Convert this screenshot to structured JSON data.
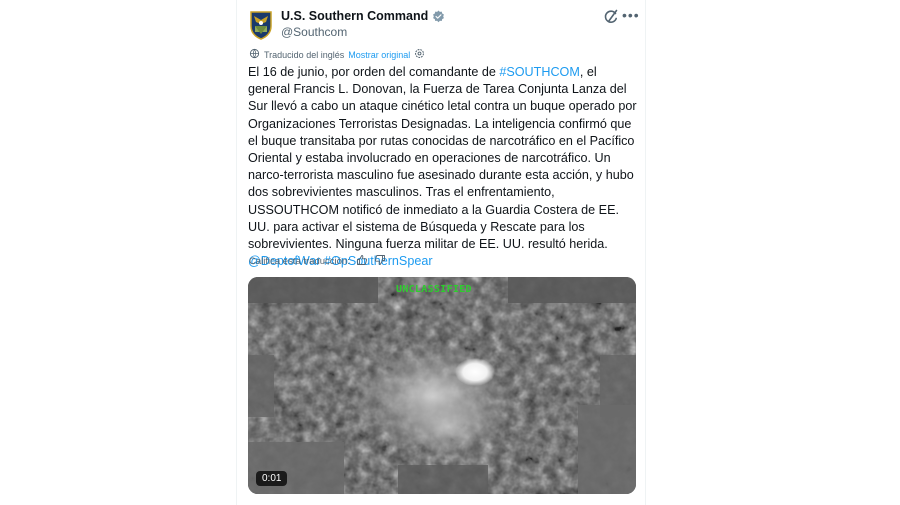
{
  "account": {
    "display_name": "U.S. Southern Command",
    "handle": "@Southcom",
    "avatar_icon": "southcom-seal-icon",
    "verified_icon": "verified-badge-icon",
    "accent_color": "#1d9bf0"
  },
  "translation": {
    "label": "Traducido del inglés",
    "show_original": "Mostrar original"
  },
  "post": {
    "text_parts": [
      "El 16 de junio, por orden del comandante de ",
      "#SOUTHCOM",
      ", el general Francis L. Donovan, la Fuerza de Tarea Conjunta Lanza del Sur llevó a cabo un ataque cinético letal contra un buque operado por Organizaciones Terroristas Designadas. La inteligencia confirmó que el buque transitaba por rutas conocidas de narcotráfico en el Pacífico Oriental y estaba involucrado en operaciones de narcotráfico. Un narco-terrorista masculino fue asesinado durante esta acción, y hubo dos sobrevivientes masculinos. Tras el enfrentamiento, USSOUTHCOM notificó de inmediato a la Guardia Costera de EE. UU. para activar el sistema de Búsqueda y Rescate para los sobrevivientes. Ninguna fuerza militar de EE. UU. resultó herida. ",
      "@DeptofWar",
      " ",
      "#OpSouthernSpear"
    ]
  },
  "rating": {
    "label": "Califica esta traducción:"
  },
  "video": {
    "overlay_text": "UNCLASSIFIED",
    "overlay_color": "#2ecc2e",
    "timecode": "0:01"
  }
}
